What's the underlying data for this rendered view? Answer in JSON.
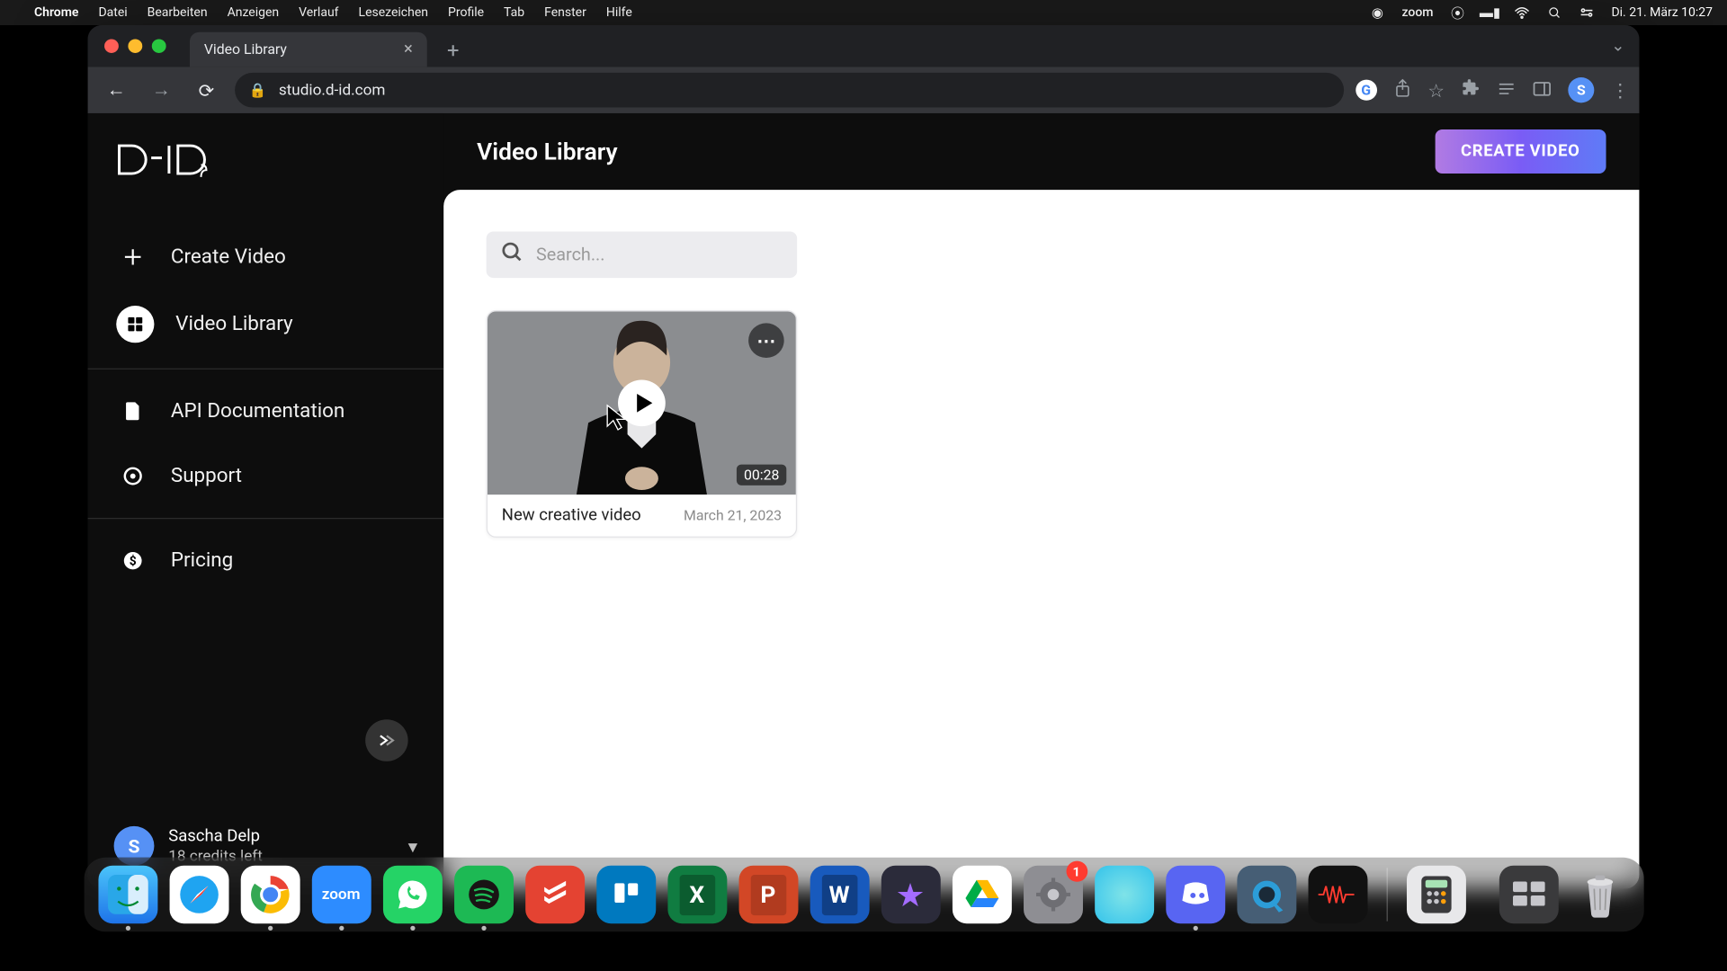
{
  "mac_menu": {
    "app_name": "Chrome",
    "items": [
      "Datei",
      "Bearbeiten",
      "Anzeigen",
      "Verlauf",
      "Lesezeichen",
      "Profile",
      "Tab",
      "Fenster",
      "Hilfe"
    ],
    "zoom_text": "zoom",
    "clock": "Di. 21. März  10:27"
  },
  "browser": {
    "tab_title": "Video Library",
    "url": "studio.d-id.com",
    "avatar_letter": "S"
  },
  "app": {
    "logo_text": "D-ID",
    "page_title": "Video Library",
    "create_button": "CREATE VIDEO",
    "search_placeholder": "Search...",
    "sidebar": {
      "items": [
        {
          "label": "Create Video"
        },
        {
          "label": "Video Library"
        },
        {
          "label": "API Documentation"
        },
        {
          "label": "Support"
        },
        {
          "label": "Pricing"
        }
      ]
    },
    "user": {
      "avatar_letter": "S",
      "name": "Sascha Delp",
      "credits": "18 credits left"
    },
    "videos": [
      {
        "title": "New creative video",
        "date": "March 21, 2023",
        "duration": "00:28"
      }
    ]
  },
  "dock": {
    "apps": [
      {
        "name": "finder",
        "color": "#1e9bf0"
      },
      {
        "name": "safari",
        "color": "#1a9af2"
      },
      {
        "name": "chrome",
        "color": "#fff"
      },
      {
        "name": "zoom",
        "color": "#2d8cff"
      },
      {
        "name": "whatsapp",
        "color": "#25d366"
      },
      {
        "name": "spotify",
        "color": "#1db954"
      },
      {
        "name": "todoist",
        "color": "#e44332"
      },
      {
        "name": "trello",
        "color": "#0079bf"
      },
      {
        "name": "excel",
        "color": "#107c41"
      },
      {
        "name": "powerpoint",
        "color": "#d24726"
      },
      {
        "name": "word",
        "color": "#185abd"
      },
      {
        "name": "imovie",
        "color": "#5856d6"
      },
      {
        "name": "drive",
        "color": "#ffba00"
      },
      {
        "name": "settings",
        "color": "#8e8e93",
        "badge": "1"
      },
      {
        "name": "siri",
        "color": "#34c3eb"
      },
      {
        "name": "discord",
        "color": "#5865f2"
      },
      {
        "name": "quicktime",
        "color": "#3498db"
      },
      {
        "name": "voice-memos",
        "color": "#111"
      }
    ],
    "apps_right": [
      {
        "name": "calculator",
        "color": "#d0d0d0"
      },
      {
        "name": "mission-control",
        "color": "#444"
      },
      {
        "name": "trash",
        "color": "#cfcfcf"
      }
    ]
  }
}
